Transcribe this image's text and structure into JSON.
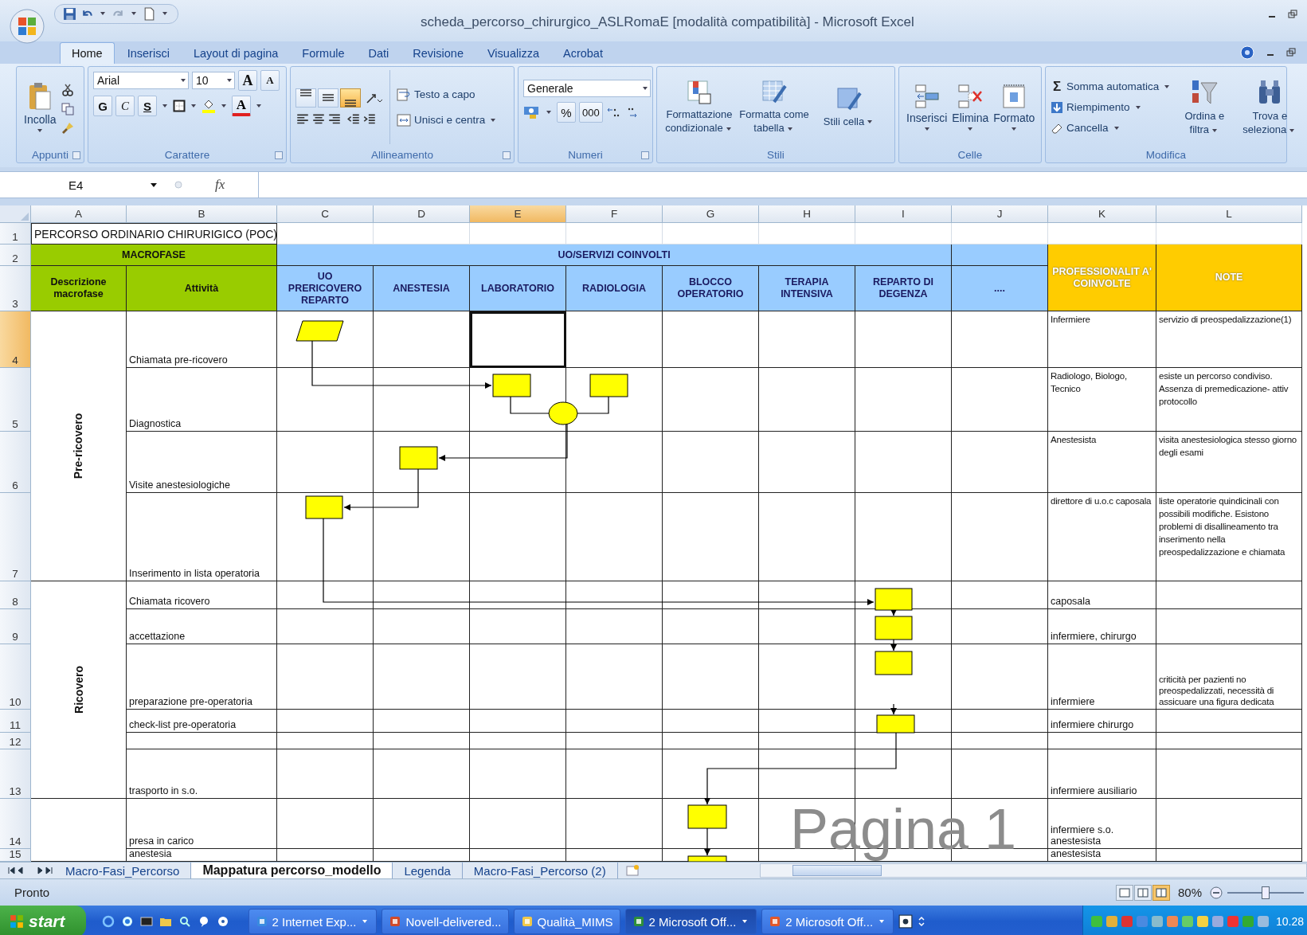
{
  "window": {
    "title": "scheda_percorso_chirurgico_ASLRomaE  [modalità compatibilità] - Microsoft Excel"
  },
  "ribbon_tabs": [
    {
      "label": "Home",
      "selected": true
    },
    {
      "label": "Inserisci",
      "selected": false
    },
    {
      "label": "Layout di pagina",
      "selected": false
    },
    {
      "label": "Formule",
      "selected": false
    },
    {
      "label": "Dati",
      "selected": false
    },
    {
      "label": "Revisione",
      "selected": false
    },
    {
      "label": "Visualizza",
      "selected": false
    },
    {
      "label": "Acrobat",
      "selected": false
    }
  ],
  "ribbon": {
    "appunti": {
      "title": "Appunti",
      "paste": "Incolla"
    },
    "carattere": {
      "title": "Carattere",
      "font": "Arial",
      "size": "10",
      "grow": "A",
      "shrink": "A",
      "bold": "G",
      "italic": "C",
      "underline": "S",
      "font_color": "A"
    },
    "allineamento": {
      "title": "Allineamento",
      "valign": [
        {
          "selected": false
        },
        {
          "selected": false
        },
        {
          "selected": true
        }
      ],
      "wrap": "Testo a capo",
      "merge": "Unisci e centra"
    },
    "numeri": {
      "title": "Numeri",
      "format": "Generale",
      "percent": "%",
      "thousands": "000"
    },
    "stili": {
      "title": "Stili",
      "buttons": [
        "Formattazione condizionale",
        "Formatta come tabella",
        "Stili cella"
      ]
    },
    "celle": {
      "title": "Celle",
      "buttons": [
        "Inserisci",
        "Elimina",
        "Formato"
      ]
    },
    "modifica": {
      "title": "Modifica",
      "sum_symbol": "Σ",
      "sum": "Somma automatica",
      "fill": "Riempimento",
      "clear": "Cancella",
      "sort": "Ordina e filtra",
      "find": "Trova e seleziona"
    }
  },
  "formula_bar": {
    "cell": "E4",
    "fx": "fx"
  },
  "sheet": {
    "columns": [
      {
        "letter": "A",
        "selected": false
      },
      {
        "letter": "B",
        "selected": false
      },
      {
        "letter": "C",
        "selected": false
      },
      {
        "letter": "D",
        "selected": false
      },
      {
        "letter": "E",
        "selected": true
      },
      {
        "letter": "F",
        "selected": false
      },
      {
        "letter": "G",
        "selected": false
      },
      {
        "letter": "H",
        "selected": false
      },
      {
        "letter": "I",
        "selected": false
      },
      {
        "letter": "J",
        "selected": false
      },
      {
        "letter": "K",
        "selected": false
      },
      {
        "letter": "L",
        "selected": false
      }
    ],
    "title_row": {
      "number": "1",
      "text": "PERCORSO ORDINARIO CHIRURIGICO (POC)"
    },
    "group_row": {
      "number": "2",
      "macrofase": "MACROFASE",
      "services": "UO/SERVIZI COINVOLTI",
      "professionals": "PROFESSIONALIT A' COINVOLTE",
      "notes": "NOTE"
    },
    "header_row": {
      "number": "3",
      "phase": "Descrizione macrofase",
      "activity": "Attività",
      "services": [
        "UO PRERICOVERO REPARTO",
        "ANESTESIA",
        "LABORATORIO",
        "RADIOLOGIA",
        "BLOCCO OPERATORIO",
        "TERAPIA INTENSIVA",
        "REPARTO DI DEGENZA",
        "...."
      ]
    },
    "phases": [
      {
        "label": "Pre-ricovero",
        "rows": [
          {
            "number": "4",
            "selected": true,
            "activity": "Chiamata pre-ricovero",
            "professionals": "Infermiere",
            "notes": "servizio di  preospedalizzazione(1)"
          },
          {
            "number": "5",
            "selected": false,
            "activity": "Diagnostica",
            "professionals": "Radiologo, Biologo, Tecnico",
            "notes": "esiste un percorso condiviso. Assenza di premedicazione- attiv protocollo"
          },
          {
            "number": "6",
            "selected": false,
            "activity": "Visite anestesiologiche",
            "professionals": "Anestesista",
            "notes": "visita anestesiologica stesso giorno degli esami"
          },
          {
            "number": "7",
            "selected": false,
            "activity": "Inserimento in lista operatoria",
            "professionals": "direttore di u.o.c caposala",
            "notes": "liste operatorie quindicinali con possibili modifiche. Esistono problemi di disallineamento tra inserimento nella preospedalizzazione e chiamata"
          }
        ]
      },
      {
        "label": "Ricovero",
        "rows": [
          {
            "number": "8",
            "selected": false,
            "activity": "Chiamata ricovero",
            "professionals": "caposala"
          },
          {
            "number": "9",
            "selected": false,
            "activity": "accettazione",
            "professionals": "infermiere, chirurgo"
          },
          {
            "number": "10",
            "selected": false,
            "activity": "preparazione pre-operatoria",
            "professionals": "infermiere",
            "notes": "criticità per pazienti no preospedalizzati, necessità di assicuare una figura dedicata"
          },
          {
            "number": "11",
            "selected": false,
            "activity": "check-list pre-operatoria",
            "professionals": "infermiere chirurgo"
          },
          {
            "number": "12",
            "selected": false
          },
          {
            "number": "13",
            "selected": false,
            "activity": "trasporto in s.o.",
            "professionals": "infermiere ausiliario"
          }
        ]
      },
      {
        "rows": [
          {
            "number": "14",
            "selected": false,
            "activity": "presa in carico",
            "professionals": "infermiere s.o. anestesista"
          },
          {
            "number": "15",
            "selected": false,
            "activity": "anestesia",
            "professionals": "anestesista"
          }
        ]
      }
    ],
    "page_label": "Pagina 1"
  },
  "sheet_tabs": [
    {
      "label": "Macro-Fasi_Percorso",
      "selected": false
    },
    {
      "label": "Mappatura percorso_modello",
      "selected": true
    },
    {
      "label": "Legenda",
      "selected": false
    },
    {
      "label": "Macro-Fasi_Percorso (2)",
      "selected": false
    }
  ],
  "status_bar": {
    "text": "Pronto",
    "views": [
      {
        "selected": false
      },
      {
        "selected": false
      },
      {
        "selected": true
      }
    ],
    "zoom": "80%",
    "zoom_slider": {
      "level": 0.5
    }
  },
  "taskbar": {
    "start": "start",
    "tasks": [
      {
        "label": "2 Internet Exp...",
        "selected": false
      },
      {
        "label": "Novell-delivered...",
        "selected": false
      },
      {
        "label": "Qualità_MIMS",
        "selected": false
      },
      {
        "label": "2 Microsoft Off...",
        "selected": true
      },
      {
        "label": "2 Microsoft Off...",
        "selected": false
      }
    ],
    "clock": "10.28"
  }
}
